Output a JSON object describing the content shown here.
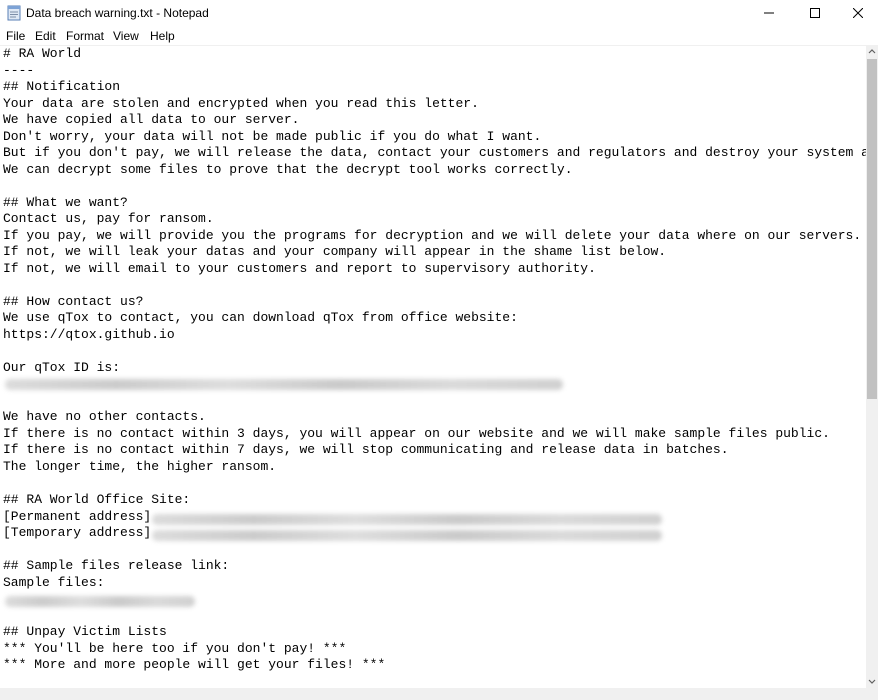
{
  "window": {
    "title": "Data breach warning.txt - Notepad",
    "buttons": [
      "minimize",
      "maximize",
      "close"
    ]
  },
  "menu": {
    "items": [
      "File",
      "Edit",
      "Format",
      "View",
      "Help"
    ]
  },
  "document": {
    "lines": [
      "# RA World",
      "----",
      "## Notification",
      "Your data are stolen and encrypted when you read this letter.",
      "We have copied all data to our server.",
      "Don't worry, your data will not be made public if you do what I want.",
      "But if you don't pay, we will release the data, contact your customers and regulators and destroy your system again.",
      "We can decrypt some files to prove that the decrypt tool works correctly.",
      "",
      "## What we want?",
      "Contact us, pay for ransom.",
      "If you pay, we will provide you the programs for decryption and we will delete your data where on our servers.",
      "If not, we will leak your datas and your company will appear in the shame list below.",
      "If not, we will email to your customers and report to supervisory authority.",
      "",
      "## How contact us?",
      "We use qTox to contact, you can download qTox from office website:",
      "https://qtox.github.io",
      "",
      "Our qTox ID is:",
      "",
      "",
      "We have no other contacts.",
      "If there is no contact within 3 days, you will appear on our website and we will make sample files public.",
      "If there is no contact within 7 days, we will stop communicating and release data in batches.",
      "The longer time, the higher ransom.",
      "",
      "## RA World Office Site:",
      "[Permanent address]",
      "[Temporary address]",
      "",
      "## Sample files release link:",
      "Sample files:",
      "",
      "",
      "## Unpay Victim Lists",
      "*** You'll be here too if you don't pay! ***",
      "*** More and more people will get your files! ***"
    ]
  },
  "colors": {
    "scrollbar_track": "#f0f0f0",
    "scrollbar_thumb": "#c1c1c1",
    "text": "#000000"
  }
}
